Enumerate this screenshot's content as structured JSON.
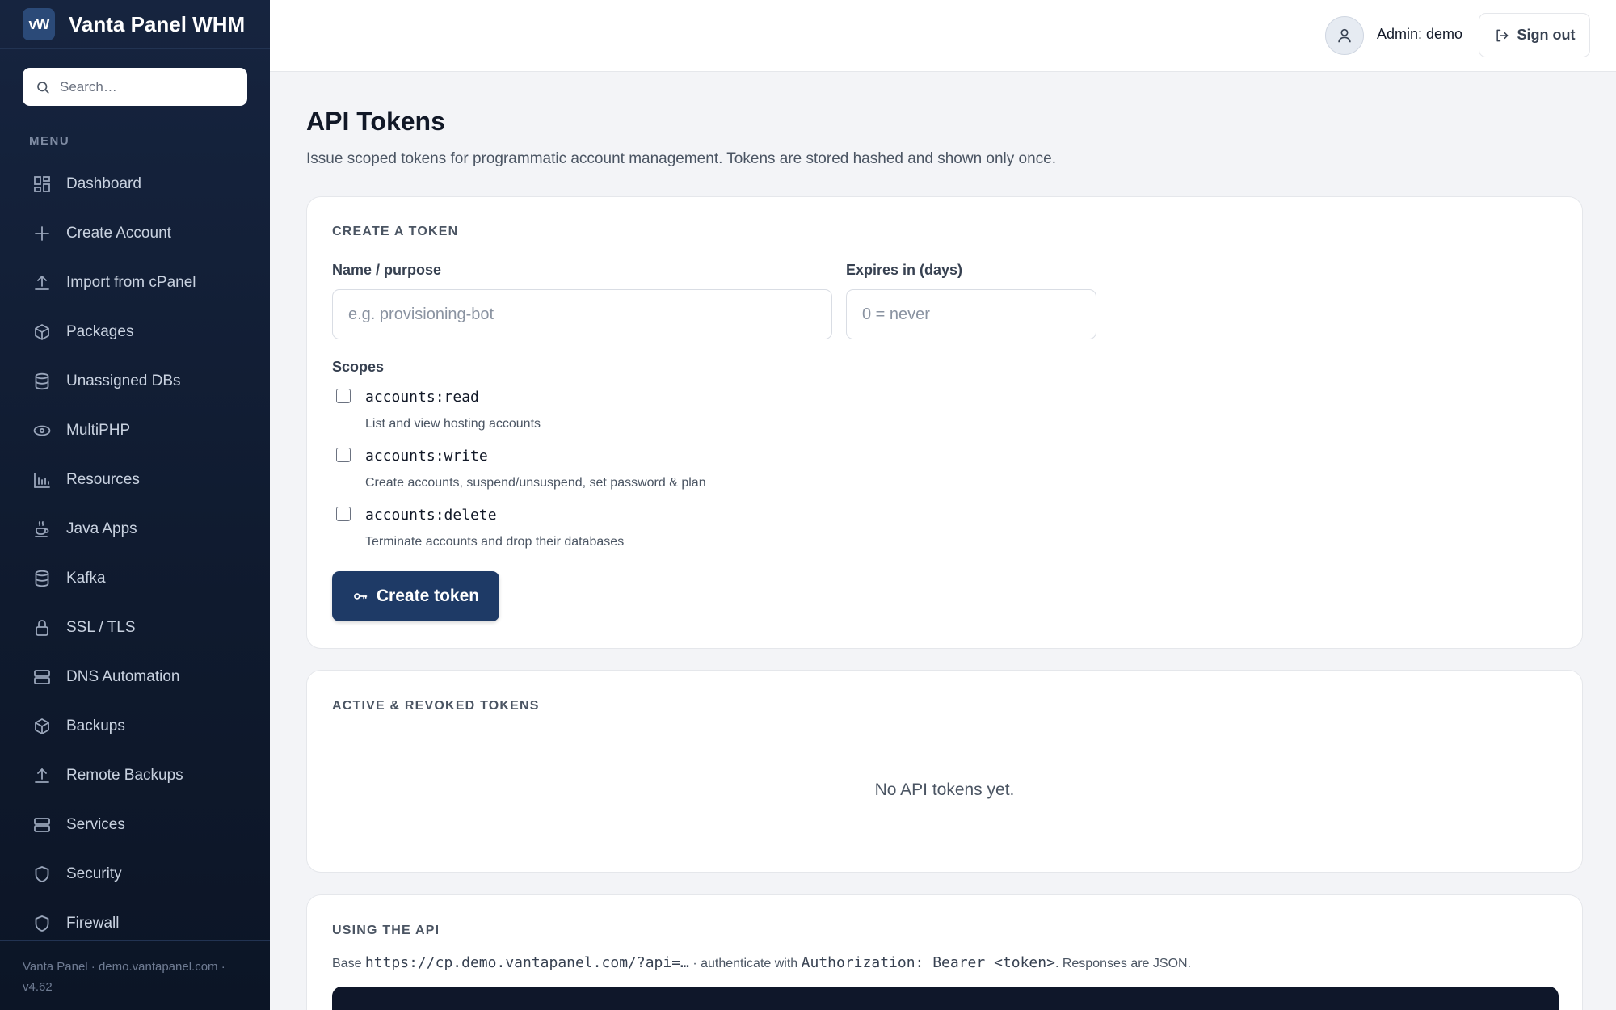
{
  "brand": {
    "logo_text": "vW",
    "name": "Vanta Panel WHM"
  },
  "search": {
    "placeholder": "Search…"
  },
  "sidebar": {
    "menu_label": "MENU",
    "items": [
      {
        "label": "Dashboard",
        "icon": "dashboard-icon"
      },
      {
        "label": "Create Account",
        "icon": "plus-icon"
      },
      {
        "label": "Import from cPanel",
        "icon": "upload-icon"
      },
      {
        "label": "Packages",
        "icon": "package-icon"
      },
      {
        "label": "Unassigned DBs",
        "icon": "database-icon"
      },
      {
        "label": "MultiPHP",
        "icon": "php-icon"
      },
      {
        "label": "Resources",
        "icon": "bar-chart-icon"
      },
      {
        "label": "Java Apps",
        "icon": "coffee-icon"
      },
      {
        "label": "Kafka",
        "icon": "database-icon"
      },
      {
        "label": "SSL / TLS",
        "icon": "lock-icon"
      },
      {
        "label": "DNS Automation",
        "icon": "server-icon"
      },
      {
        "label": "Backups",
        "icon": "package-icon"
      },
      {
        "label": "Remote Backups",
        "icon": "upload-icon"
      },
      {
        "label": "Services",
        "icon": "server-icon"
      },
      {
        "label": "Security",
        "icon": "shield-icon"
      },
      {
        "label": "Firewall",
        "icon": "shield-icon"
      }
    ],
    "footer": "Vanta Panel · demo.vantapanel.com · v4.62"
  },
  "topbar": {
    "admin_label": "Admin: demo",
    "signout_label": "Sign out"
  },
  "page": {
    "title": "API Tokens",
    "subtitle": "Issue scoped tokens for programmatic account management. Tokens are stored hashed and shown only once."
  },
  "create": {
    "title": "CREATE A TOKEN",
    "name_label": "Name / purpose",
    "name_placeholder": "e.g. provisioning-bot",
    "expires_label": "Expires in (days)",
    "expires_placeholder": "0 = never",
    "scopes_label": "Scopes",
    "scopes": [
      {
        "code": "accounts:read",
        "desc": "List and view hosting accounts",
        "checked": false
      },
      {
        "code": "accounts:write",
        "desc": "Create accounts, suspend/unsuspend, set password & plan",
        "checked": false
      },
      {
        "code": "accounts:delete",
        "desc": "Terminate accounts and drop their databases",
        "checked": false
      }
    ],
    "button_label": "Create token"
  },
  "tokens": {
    "title": "ACTIVE & REVOKED TOKENS",
    "empty": "No API tokens yet."
  },
  "api": {
    "title": "USING THE API",
    "base_prefix": "Base",
    "base_url": "https://cp.demo.vantapanel.com/?api=…",
    "mid_text": "· authenticate with",
    "auth_header": "Authorization: Bearer <token>",
    "suffix": ". Responses are JSON."
  },
  "colors": {
    "sidebar_bg": "#16243f",
    "primary_button": "#1e3a66",
    "page_bg": "#f3f4f7"
  }
}
